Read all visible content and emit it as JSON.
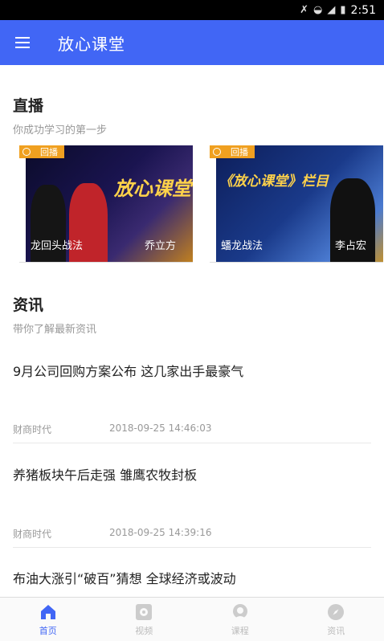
{
  "status_bar": {
    "time": "2:51"
  },
  "app_bar": {
    "title": "放心课堂"
  },
  "live": {
    "title": "直播",
    "subtitle": "你成功学习的第一步",
    "cards": [
      {
        "badge": "回播",
        "headline": "放心课堂",
        "label": "龙回头战法",
        "name": "乔立方"
      },
      {
        "badge": "回播",
        "headline": "《放心课堂》栏目",
        "label": "蟠龙战法",
        "name": "李占宏"
      }
    ]
  },
  "news": {
    "title": "资讯",
    "subtitle": "带你了解最新资讯",
    "items": [
      {
        "title": "9月公司回购方案公布 这几家出手最豪气",
        "source": "财商时代",
        "date": "2018-09-25 14:46:03"
      },
      {
        "title": "养猪板块午后走强 雏鹰农牧封板",
        "source": "财商时代",
        "date": "2018-09-25 14:39:16"
      },
      {
        "title": "布油大涨引“破百”猜想 全球经济或波动"
      }
    ]
  },
  "bottom_nav": [
    {
      "label": "首页",
      "icon": "home-icon",
      "active": true
    },
    {
      "label": "视频",
      "icon": "video-icon",
      "active": false
    },
    {
      "label": "课程",
      "icon": "course-icon",
      "active": false
    },
    {
      "label": "资讯",
      "icon": "compass-icon",
      "active": false
    }
  ],
  "colors": {
    "primary": "#4166f5",
    "badge": "#f0a020"
  }
}
